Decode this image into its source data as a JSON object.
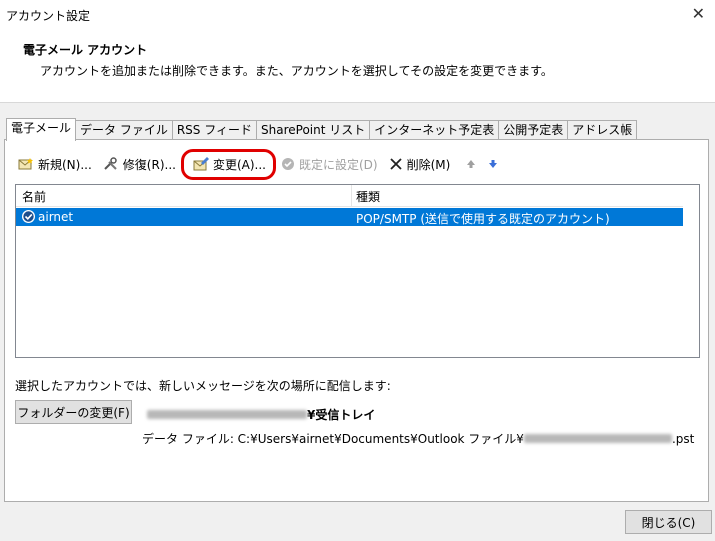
{
  "window": {
    "title": "アカウント設定",
    "close_glyph": "✕"
  },
  "header": {
    "title": "電子メール アカウント",
    "description": "アカウントを追加または削除できます。また、アカウントを選択してその設定を変更できます。"
  },
  "tabs": [
    {
      "label": "電子メール",
      "active": true
    },
    {
      "label": "データ ファイル"
    },
    {
      "label": "RSS フィード"
    },
    {
      "label": "SharePoint リスト"
    },
    {
      "label": "インターネット予定表"
    },
    {
      "label": "公開予定表"
    },
    {
      "label": "アドレス帳"
    }
  ],
  "toolbar": {
    "new_label": "新規(N)...",
    "repair_label": "修復(R)...",
    "change_label": "変更(A)...",
    "set_default_label": "既定に設定(D)",
    "delete_label": "削除(M)",
    "icons": [
      "new-mail-icon",
      "repair-tools-icon",
      "change-icon",
      "set-default-icon",
      "delete-x-icon",
      "move-up-icon",
      "move-down-icon"
    ]
  },
  "accounts": {
    "columns": {
      "name": "名前",
      "type": "種類"
    },
    "rows": [
      {
        "name": "airnet",
        "type": "POP/SMTP (送信で使用する既定のアカウント)",
        "selected": true
      }
    ]
  },
  "delivery": {
    "label": "選択したアカウントでは、新しいメッセージを次の場所に配信します:",
    "folder_button": "フォルダーの変更(F)",
    "inbox_suffix": "¥受信トレイ",
    "datafile_prefix": "データ ファイル: C:¥Users¥airnet¥Documents¥Outlook ファイル¥",
    "datafile_suffix": ".pst"
  },
  "close_button": "閉じる(C)",
  "colors": {
    "selection": "#0078d7",
    "highlight_ring": "#e00000"
  }
}
